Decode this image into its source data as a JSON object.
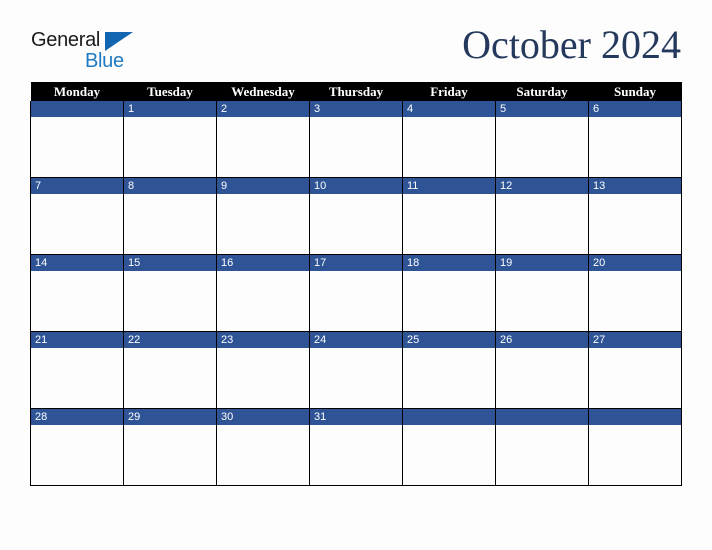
{
  "brand": {
    "name_part1": "General",
    "name_part2": "Blue",
    "triangle_icon": "blue-triangle-icon",
    "color_dark": "#1b1b1b",
    "color_blue": "#1f7ac4",
    "triangle_color": "#1265b0"
  },
  "header": {
    "title": "October 2024",
    "title_color": "#25395c"
  },
  "calendar": {
    "month": "October",
    "year": "2024",
    "accent_color": "#2e5496",
    "header_bg": "#000000",
    "header_text_color": "#ffffff",
    "weekday_headers": [
      "Monday",
      "Tuesday",
      "Wednesday",
      "Thursday",
      "Friday",
      "Saturday",
      "Sunday"
    ],
    "weeks": [
      [
        "",
        "1",
        "2",
        "3",
        "4",
        "5",
        "6"
      ],
      [
        "7",
        "8",
        "9",
        "10",
        "11",
        "12",
        "13"
      ],
      [
        "14",
        "15",
        "16",
        "17",
        "18",
        "19",
        "20"
      ],
      [
        "21",
        "22",
        "23",
        "24",
        "25",
        "26",
        "27"
      ],
      [
        "28",
        "29",
        "30",
        "31",
        "",
        "",
        ""
      ]
    ]
  }
}
